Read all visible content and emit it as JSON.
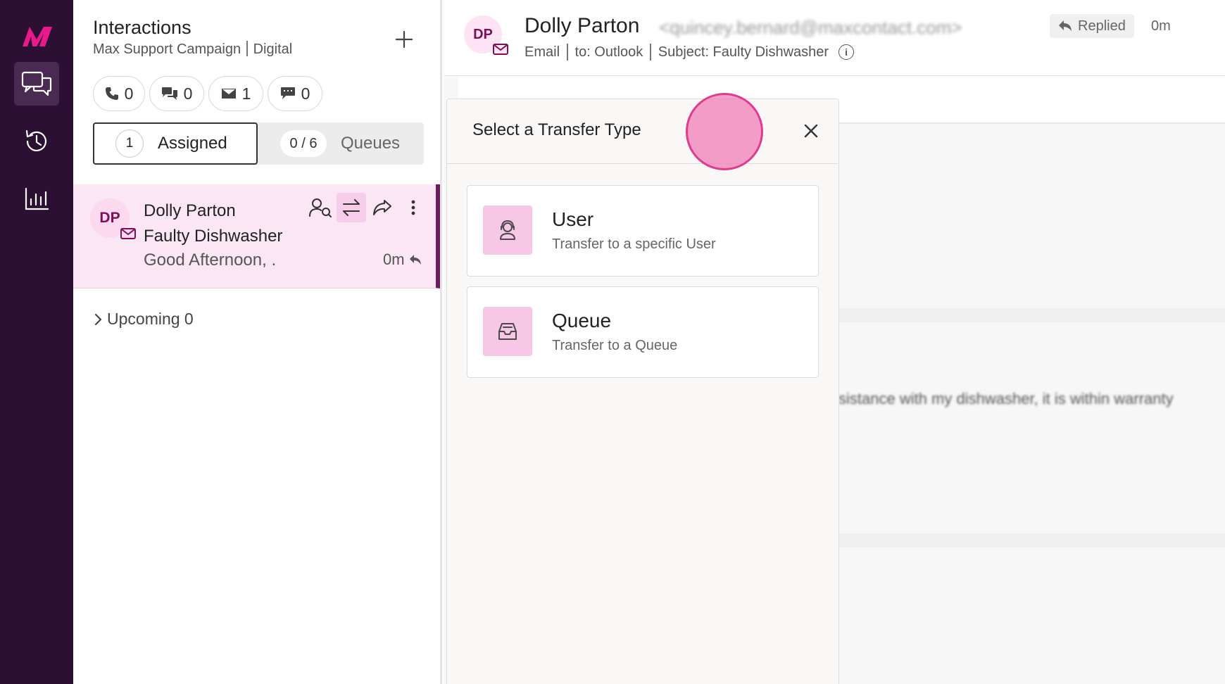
{
  "rail": {
    "logo": "M",
    "items": [
      {
        "name": "conversations",
        "active": true
      },
      {
        "name": "history",
        "active": false
      },
      {
        "name": "reports",
        "active": false
      }
    ]
  },
  "interactions": {
    "title": "Interactions",
    "campaign": "Max Support Campaign",
    "channel": "Digital",
    "counters": {
      "calls": "0",
      "chats": "0",
      "emails": "1",
      "messages": "0"
    },
    "assigned": {
      "count": "1",
      "label": "Assigned"
    },
    "queues": {
      "count": "0 / 6",
      "label": "Queues"
    },
    "conversation": {
      "initials": "DP",
      "name": "Dolly Parton",
      "subject": "Faulty Dishwasher",
      "preview": "Good Afternoon, .",
      "time": "0m"
    },
    "upcoming": "Upcoming 0"
  },
  "header": {
    "initials": "DP",
    "name": "Dolly Parton",
    "email": "<quincey.bernard@maxcontact.com>",
    "status": "Replied",
    "time": "0m",
    "channel": "Email",
    "to": "to: Outlook",
    "subject": "Subject: Faulty Dishwasher"
  },
  "background": {
    "body_text": "sistance with my dishwasher, it is within warranty"
  },
  "dialog": {
    "title": "Select a Transfer Type",
    "options": [
      {
        "title": "User",
        "description": "Transfer to a specific User"
      },
      {
        "title": "Queue",
        "description": "Transfer to a Queue"
      }
    ]
  },
  "colors": {
    "rail": "#2c1034",
    "accent": "#7a1158",
    "highlight": "#fbe6f4",
    "icon_tile": "#f7c8e6",
    "cursor": "#e03c8f"
  }
}
